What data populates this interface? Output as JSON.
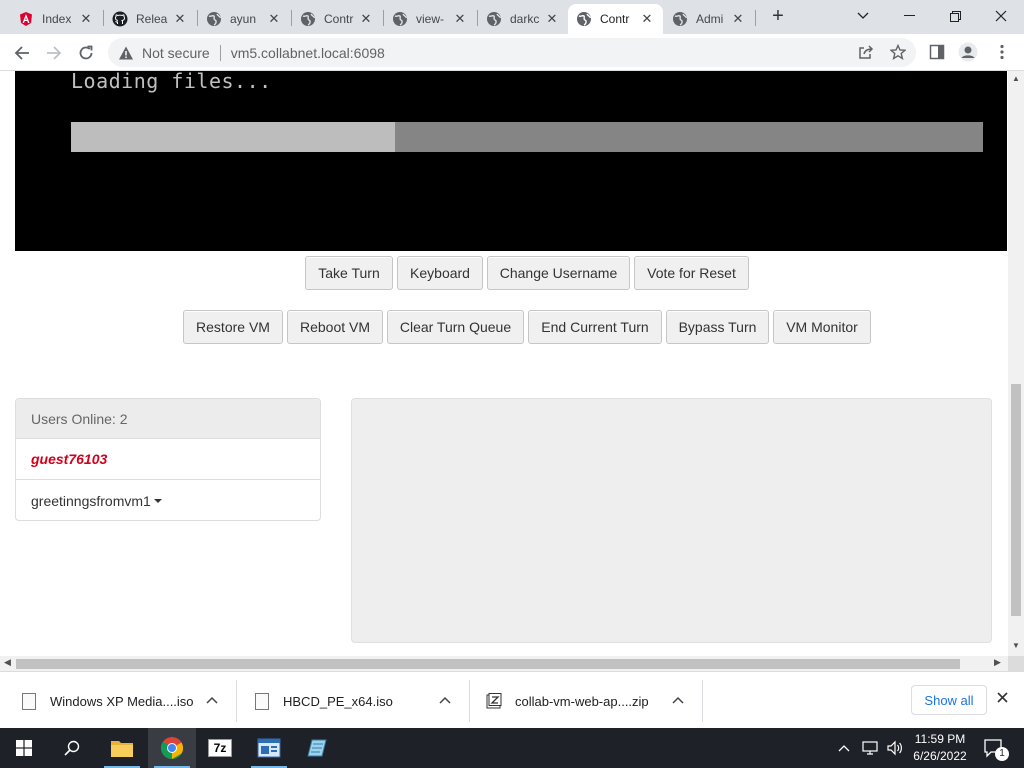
{
  "browser": {
    "tabs": [
      {
        "title": "Index",
        "icon": "angular-icon",
        "active": false
      },
      {
        "title": "Relea",
        "icon": "github-icon",
        "active": false
      },
      {
        "title": "ayun",
        "icon": "globe-icon",
        "active": false
      },
      {
        "title": "Contr",
        "icon": "globe-icon",
        "active": false
      },
      {
        "title": "view-",
        "icon": "globe-icon",
        "active": false
      },
      {
        "title": "darkc",
        "icon": "globe-icon",
        "active": false
      },
      {
        "title": "Contr",
        "icon": "globe-icon",
        "active": true
      },
      {
        "title": "Admi",
        "icon": "globe-icon",
        "active": false
      }
    ],
    "security_label": "Not secure",
    "url": "vm5.collabnet.local:6098"
  },
  "vm": {
    "screen_text": "Loading files...",
    "progress_fraction": 0.355
  },
  "controls": {
    "row1": [
      "Take Turn",
      "Keyboard",
      "Change Username",
      "Vote for Reset"
    ],
    "row2": [
      "Restore VM",
      "Reboot VM",
      "Clear Turn Queue",
      "End Current Turn",
      "Bypass Turn",
      "VM Monitor"
    ]
  },
  "users": {
    "header": "Users Online: 2",
    "list": [
      {
        "name": "guest76103",
        "style": "guest"
      },
      {
        "name": "greetinngsfromvm1",
        "style": "admin"
      }
    ]
  },
  "downloads": {
    "items": [
      "Windows XP Media....iso",
      "HBCD_PE_x64.iso",
      "collab-vm-web-ap....zip"
    ],
    "show_all": "Show all"
  },
  "taskbar": {
    "time": "11:59 PM",
    "date": "6/26/2022",
    "notifications": "1",
    "app_7z": "7z"
  },
  "colors": {
    "guest_name": "#d0021b",
    "vm_background": "#000000",
    "accent": "#1a73e8"
  }
}
